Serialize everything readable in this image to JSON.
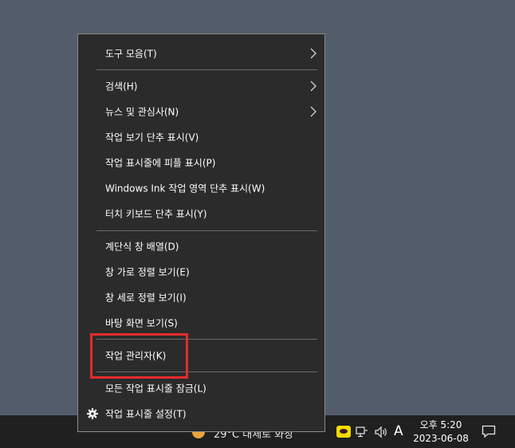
{
  "context_menu": {
    "items": [
      {
        "label": "도구 모음(T)",
        "submenu": true
      },
      {
        "label": "검색(H)",
        "submenu": true
      },
      {
        "label": "뉴스 및 관심사(N)",
        "submenu": true
      },
      {
        "label": "작업 보기 단추 표시(V)"
      },
      {
        "label": "작업 표시줄에 피플 표시(P)"
      },
      {
        "label": "Windows Ink 작업 영역 단추 표시(W)"
      },
      {
        "label": "터치 키보드 단추 표시(Y)"
      },
      {
        "label": "계단식 창 배열(D)"
      },
      {
        "label": "창 가로 정렬 보기(E)"
      },
      {
        "label": "창 세로 정렬 보기(I)"
      },
      {
        "label": "바탕 화면 보기(S)"
      },
      {
        "label": "작업 관리자(K)",
        "highlighted": true
      },
      {
        "label": "모든 작업 표시줄 잠금(L)"
      },
      {
        "label": "작업 표시줄 설정(T)",
        "icon": "gear-icon"
      }
    ],
    "highlight_color": "#e52b2b"
  },
  "taskbar": {
    "weather": "29°C 대체로 화창",
    "ime_indicator": "A",
    "clock_time": "오후 5:20",
    "clock_date": "2023-06-08",
    "icons": [
      "chevron-up-icon",
      "kakaotalk-icon",
      "network-icon",
      "volume-icon",
      "notification-icon"
    ]
  },
  "colors": {
    "desktop": "#525c6b",
    "menu_bg": "#2b2b2b",
    "taskbar_bg": "#202020"
  }
}
